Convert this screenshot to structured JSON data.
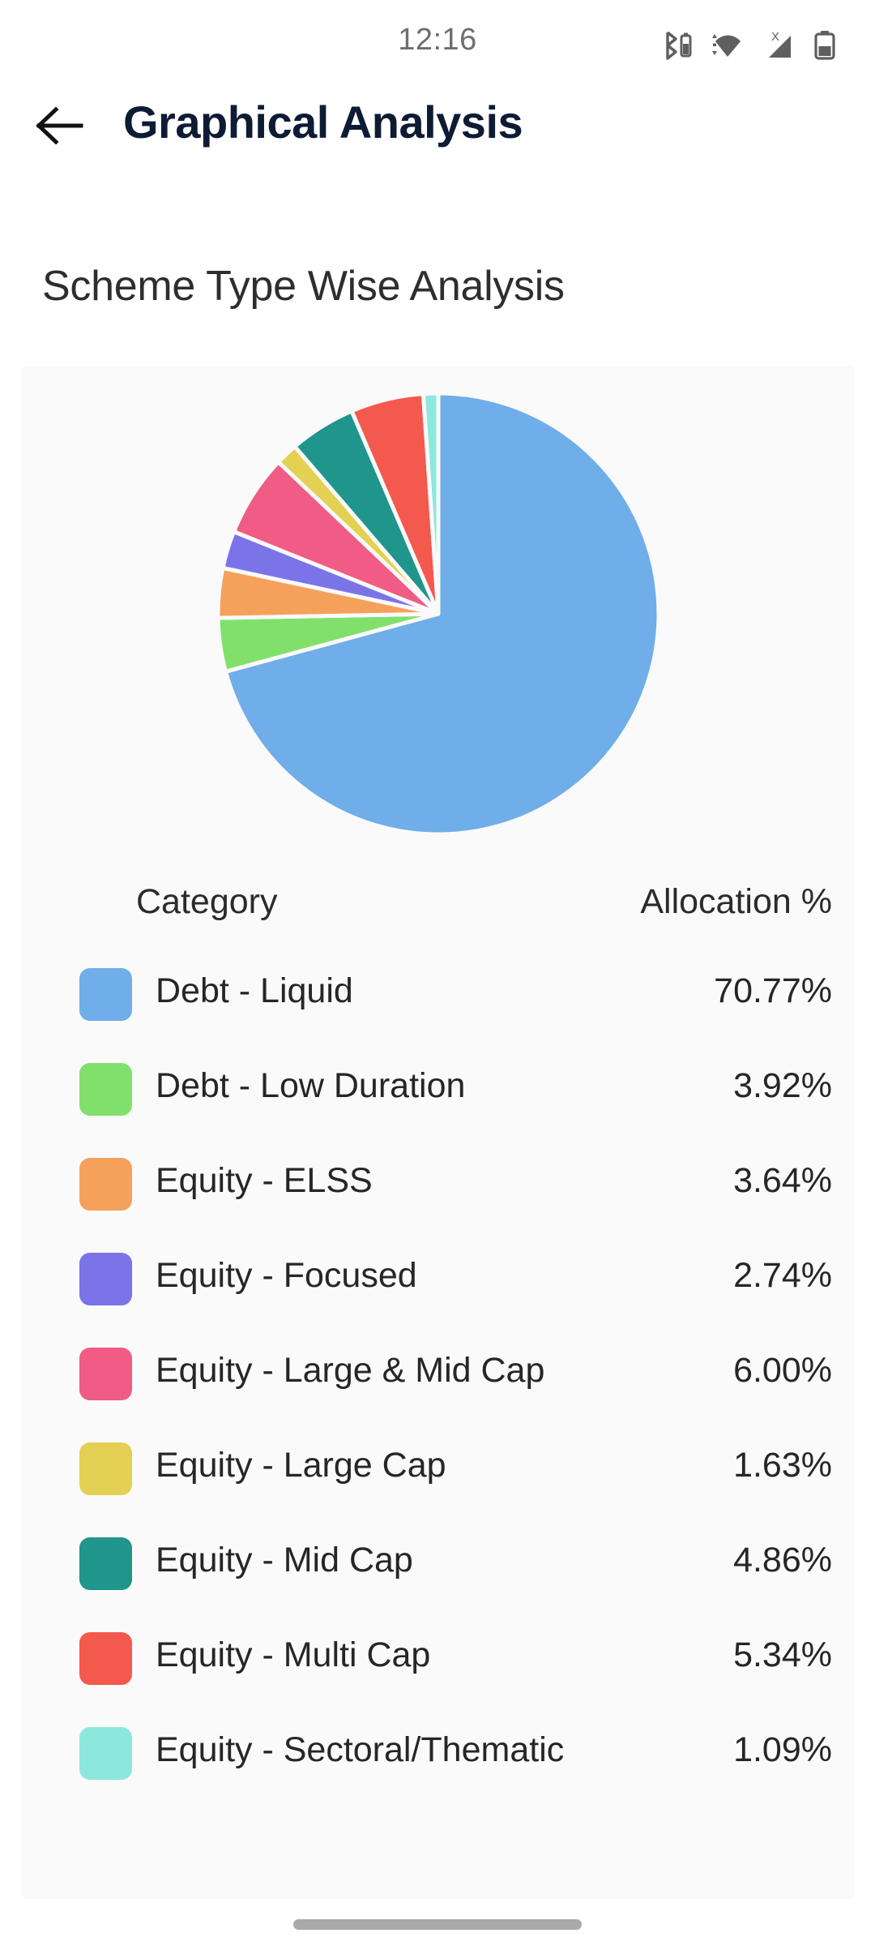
{
  "status_bar": {
    "time": "12:16",
    "icons": [
      "bluetooth-battery-icon",
      "wifi-icon",
      "no-sim-signal-icon",
      "battery-icon"
    ]
  },
  "app_bar": {
    "back_icon": "back-arrow-icon",
    "title": "Graphical Analysis"
  },
  "section": {
    "title": "Scheme Type Wise Analysis"
  },
  "table": {
    "header_category": "Category",
    "header_allocation": "Allocation %",
    "rows": [
      {
        "label": "Debt - Liquid",
        "value": "70.77%",
        "color": "#6FAEE8"
      },
      {
        "label": "Debt - Low Duration",
        "value": "3.92%",
        "color": "#81E06C"
      },
      {
        "label": "Equity - ELSS",
        "value": "3.64%",
        "color": "#F5A15C"
      },
      {
        "label": "Equity - Focused",
        "value": "2.74%",
        "color": "#7B74E8"
      },
      {
        "label": "Equity - Large & Mid Cap",
        "value": "6.00%",
        "color": "#F05C84"
      },
      {
        "label": "Equity - Large Cap",
        "value": "1.63%",
        "color": "#E4D052"
      },
      {
        "label": "Equity - Mid Cap",
        "value": "4.86%",
        "color": "#1F958C"
      },
      {
        "label": "Equity - Multi Cap",
        "value": "5.34%",
        "color": "#F4594D"
      },
      {
        "label": "Equity - Sectoral/Thematic",
        "value": "1.09%",
        "color": "#8CE8DC"
      }
    ]
  },
  "chart_data": {
    "type": "pie",
    "title": "Scheme Type Wise Analysis",
    "unit": "%",
    "legend_position": "below",
    "start_angle_deg": 0,
    "direction": "clockwise",
    "slice_gap": true,
    "categories": [
      "Debt - Liquid",
      "Debt - Low Duration",
      "Equity - ELSS",
      "Equity - Focused",
      "Equity - Large & Mid Cap",
      "Equity - Large Cap",
      "Equity - Mid Cap",
      "Equity - Multi Cap",
      "Equity - Sectoral/Thematic"
    ],
    "values": [
      70.77,
      3.92,
      3.64,
      2.74,
      6.0,
      1.63,
      4.86,
      5.34,
      1.09
    ],
    "colors": [
      "#6FAEE8",
      "#81E06C",
      "#F5A15C",
      "#7B74E8",
      "#F05C84",
      "#E4D052",
      "#1F958C",
      "#F4594D",
      "#8CE8DC"
    ],
    "total": 99.99
  },
  "home_indicator": "home-indicator-bar"
}
